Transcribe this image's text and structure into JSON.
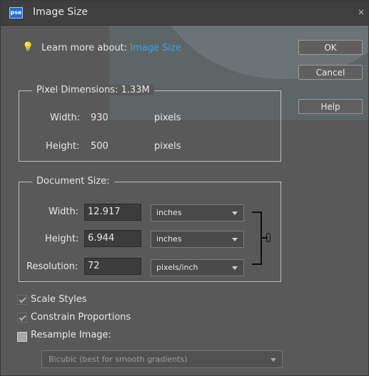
{
  "window": {
    "title": "Image Size",
    "logo_text": "pse",
    "close_glyph": "×"
  },
  "tip": {
    "icon": "lightbulb-icon",
    "label": "Learn more about:",
    "link": "Image Size"
  },
  "buttons": {
    "ok": "OK",
    "cancel": "Cancel",
    "help": "Help"
  },
  "pixel_dimensions": {
    "legend": "Pixel Dimensions: 1.33M",
    "width_label": "Width:",
    "width_value": "930",
    "width_unit": "pixels",
    "height_label": "Height:",
    "height_value": "500",
    "height_unit": "pixels"
  },
  "document_size": {
    "legend": "Document Size:",
    "width_label": "Width:",
    "width_value": "12.917",
    "width_unit": "inches",
    "height_label": "Height:",
    "height_value": "6.944",
    "height_unit": "inches",
    "resolution_label": "Resolution:",
    "resolution_value": "72",
    "resolution_unit": "pixels/inch"
  },
  "options": {
    "scale_styles": {
      "label": "Scale Styles",
      "checked": true
    },
    "constrain": {
      "label": "Constrain Proportions",
      "checked": true
    },
    "resample": {
      "label": "Resample Image:",
      "checked": false
    },
    "resample_method": "Bicubic (best for smooth gradients)"
  },
  "colors": {
    "link": "#3b9df2",
    "background": "#595959",
    "titlebar": "#3f3f3f"
  }
}
